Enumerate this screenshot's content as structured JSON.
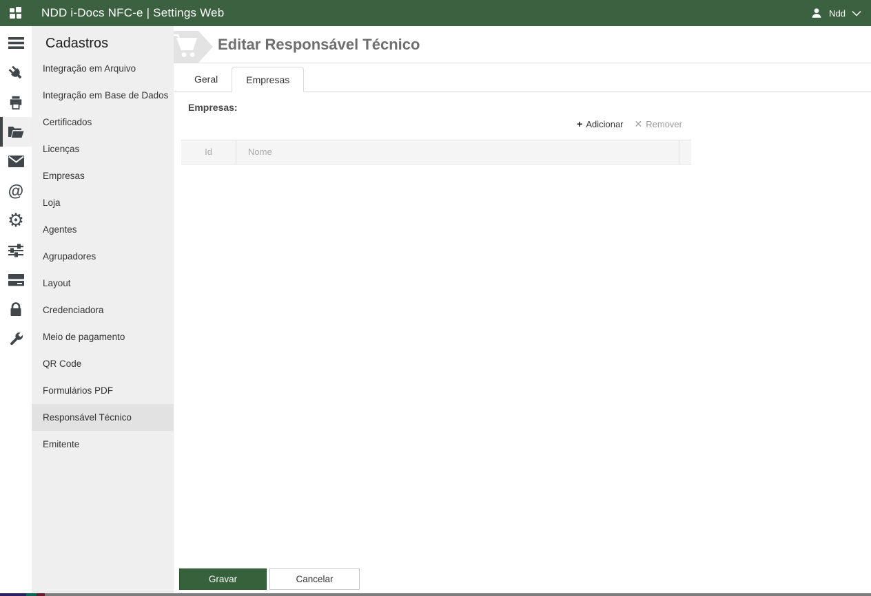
{
  "colors": {
    "topbar_green": "#3b6141",
    "save_green": "#36613a",
    "sidebar_gray": "#efefef",
    "selected_item_gray": "#e2e2e2",
    "rail_icon_gray": "#40474b",
    "taskbar_segments": [
      "#2a2061",
      "#0f6152",
      "#691b2e",
      "#7d7d7d"
    ]
  },
  "topbar": {
    "title": "NDD i-Docs NFC-e | Settings Web",
    "user_name": "Ndd"
  },
  "icon_rail": {
    "items": [
      {
        "icon": "menu-icon"
      },
      {
        "icon": "plug-icon"
      },
      {
        "icon": "printer-icon"
      },
      {
        "icon": "folder-open-icon",
        "active": true
      },
      {
        "icon": "envelope-icon"
      },
      {
        "icon": "at-sign-icon"
      },
      {
        "icon": "gear-icon"
      },
      {
        "icon": "sliders-icon"
      },
      {
        "icon": "server-icon"
      },
      {
        "icon": "lock-icon"
      },
      {
        "icon": "wrench-icon"
      }
    ]
  },
  "sidebar": {
    "title": "Cadastros",
    "items": [
      {
        "label": "Integração em Arquivo",
        "selected": false
      },
      {
        "label": "Integração em Base de Dados",
        "selected": false
      },
      {
        "label": "Certificados",
        "selected": false
      },
      {
        "label": "Licenças",
        "selected": false
      },
      {
        "label": "Empresas",
        "selected": false
      },
      {
        "label": "Loja",
        "selected": false
      },
      {
        "label": "Agentes",
        "selected": false
      },
      {
        "label": "Agrupadores",
        "selected": false
      },
      {
        "label": "Layout",
        "selected": false
      },
      {
        "label": "Credenciadora",
        "selected": false
      },
      {
        "label": "Meio de pagamento",
        "selected": false
      },
      {
        "label": "QR Code",
        "selected": false
      },
      {
        "label": "Formulários PDF",
        "selected": false
      },
      {
        "label": "Responsável Técnico",
        "selected": true
      },
      {
        "label": "Emitente",
        "selected": false
      }
    ]
  },
  "main": {
    "page_title": "Editar Responsável Técnico",
    "tabs": [
      {
        "label": "Geral",
        "active": false
      },
      {
        "label": "Empresas",
        "active": true
      }
    ],
    "section_label": "Empresas:",
    "toolbar": {
      "add_icon": "+",
      "add_label": "Adicionar",
      "remove_icon": "✕",
      "remove_label": "Remover"
    },
    "table": {
      "columns": [
        "Id",
        "Nome"
      ],
      "rows": []
    },
    "footer": {
      "save_label": "Gravar",
      "cancel_label": "Cancelar"
    }
  }
}
